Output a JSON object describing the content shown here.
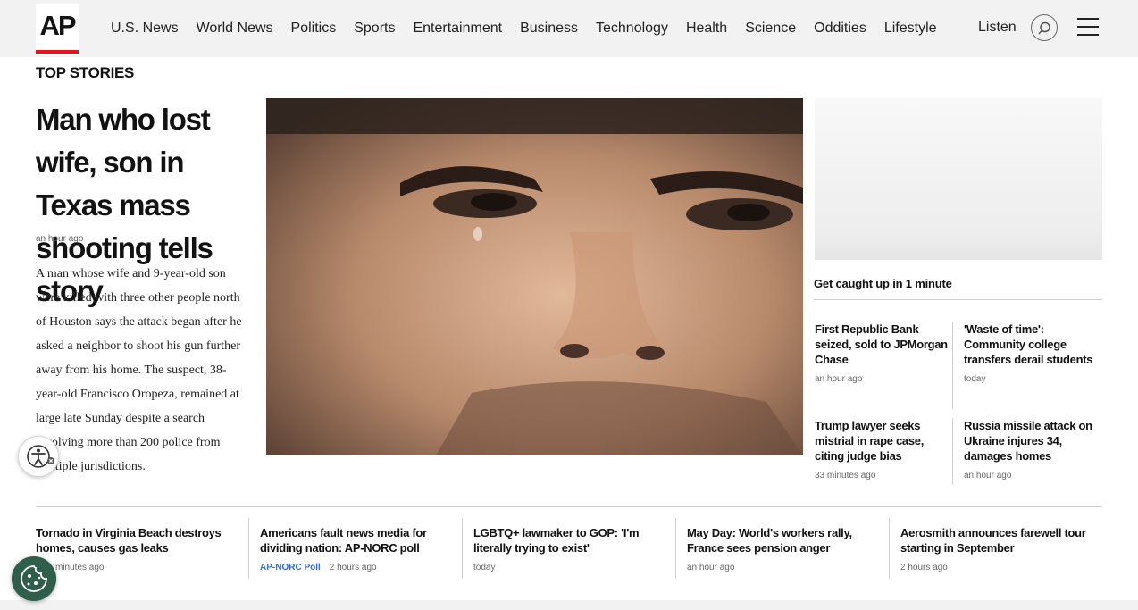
{
  "brand": {
    "logo_text": "AP",
    "accent": "#e5131d"
  },
  "nav": {
    "items": [
      "U.S. News",
      "World News",
      "Politics",
      "Sports",
      "Entertainment",
      "Business",
      "Technology",
      "Health",
      "Science",
      "Oddities",
      "Lifestyle"
    ],
    "listen_label": "Listen",
    "search_icon": "search-icon",
    "menu_icon": "hamburger-menu-icon"
  },
  "section_title": "TOP STORIES",
  "lead": {
    "headline": "Man who lost wife, son in Texas mass shooting tells story",
    "time": "an hour ago",
    "summary": "A man whose wife and 9-year-old son were killed with three other people north of Houston says the attack began after he asked a neighbor to shoot his gun further away from his home. The suspect, 38-year-old Francisco Oropeza, remained at large late Sunday despite a search involving more than 200 police from multiple jurisdictions."
  },
  "side": {
    "caught_up": "Get caught up in 1 minute",
    "cards": [
      {
        "headline": "First Republic Bank seized, sold to JPMorgan Chase",
        "time": "an hour ago"
      },
      {
        "headline": "'Waste of time': Community college transfers derail students",
        "time": "today"
      },
      {
        "headline": "Trump lawyer seeks mistrial in rape case, citing judge bias",
        "time": "33 minutes ago"
      },
      {
        "headline": "Russia missile attack on Ukraine injures 34, damages homes",
        "time": "an hour ago"
      }
    ]
  },
  "bottom": [
    {
      "headline": "Tornado in Virginia Beach destroys homes, causes gas leaks",
      "tag": "",
      "time": "minutes ago"
    },
    {
      "headline": "Americans fault news media for dividing nation: AP-NORC poll",
      "tag": "AP-NORC Poll",
      "time": "2 hours ago"
    },
    {
      "headline": "LGBTQ+ lawmaker to GOP: 'I'm literally trying to exist'",
      "tag": "",
      "time": "today"
    },
    {
      "headline": "May Day: World's workers rally, France sees pension anger",
      "tag": "",
      "time": "an hour ago"
    },
    {
      "headline": "Aerosmith announces farewell tour starting in September",
      "tag": "",
      "time": "2 hours ago"
    }
  ],
  "widgets": {
    "accessibility_icon": "accessibility-icon",
    "cookie_icon": "cookie-settings-icon"
  }
}
